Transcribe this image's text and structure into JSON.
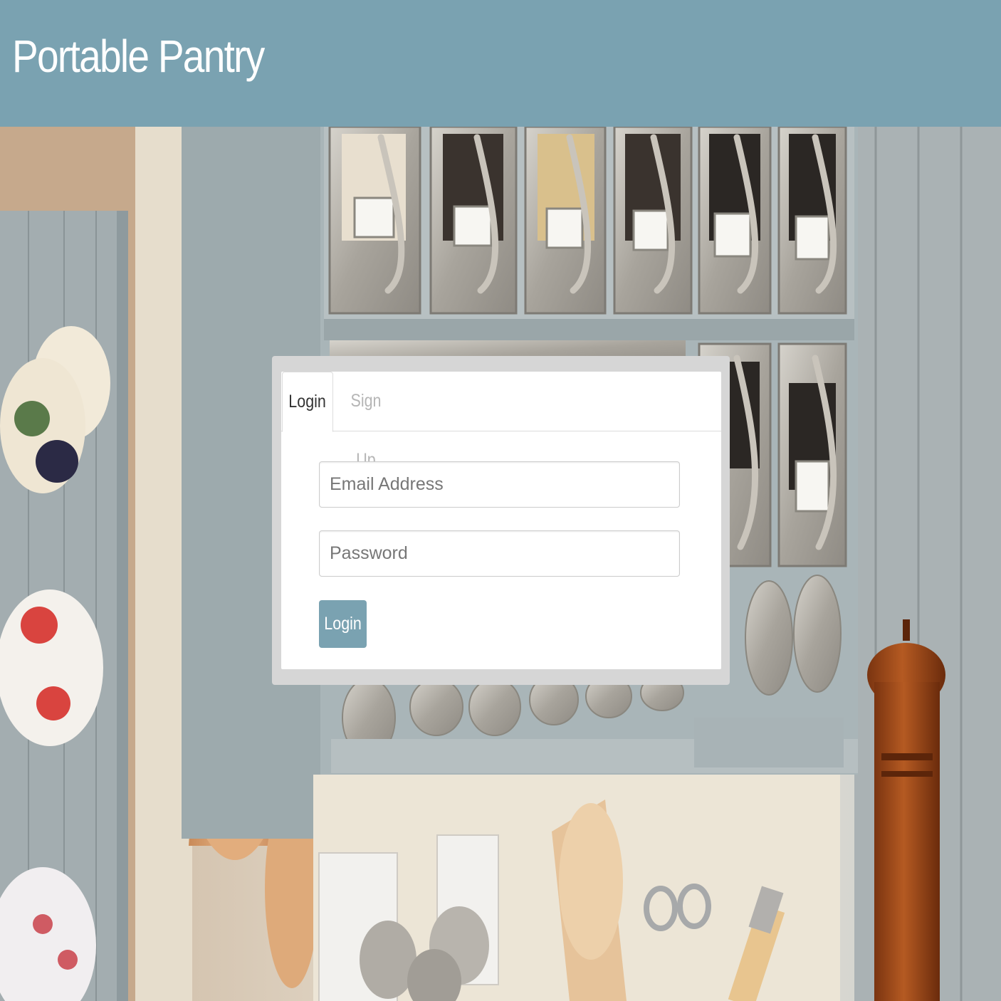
{
  "header": {
    "title": "Portable Pantry",
    "background_color": "#7aa2b1"
  },
  "background": {
    "description_icon": "kitchen-pantry-photo-icon"
  },
  "login_card": {
    "tabs": [
      {
        "label": "Login",
        "active": true
      },
      {
        "label": "Sign Up",
        "active": false
      }
    ],
    "email": {
      "placeholder": "Email Address",
      "value": ""
    },
    "password": {
      "placeholder": "Password",
      "value": ""
    },
    "submit_label": "Login",
    "accent_color": "#7aa2b1"
  }
}
